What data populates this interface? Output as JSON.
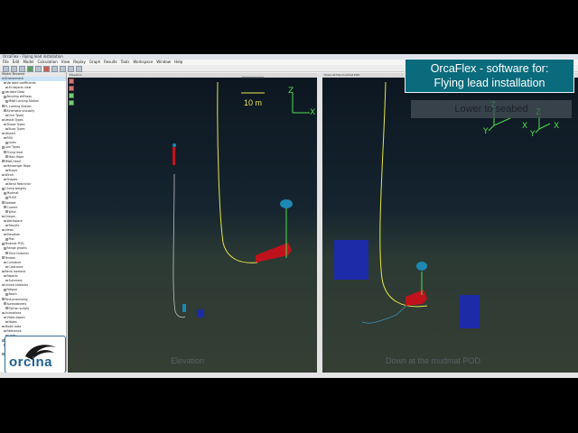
{
  "app": {
    "title": "OrcaFlex - Flying lead installation",
    "menu": [
      "File",
      "Edit",
      "Model",
      "Calculation",
      "View",
      "Replay",
      "Graph",
      "Results",
      "Tools",
      "Workspace",
      "Window",
      "Help"
    ]
  },
  "model_browser": {
    "header": "Model Browser",
    "items": [
      {
        "label": "Environment",
        "selected": true
      },
      {
        "label": "Variable coefficients"
      },
      {
        "label": "All objects view"
      },
      {
        "label": "Variable Data"
      },
      {
        "label": "Bending stiffness"
      },
      {
        "label": "MWA Locking Station"
      },
      {
        "label": "FL Locking Station"
      },
      {
        "label": "Kinematic viscosity"
      },
      {
        "label": "Line Types"
      },
      {
        "label": "Vessel Types"
      },
      {
        "label": "Shape Types"
      },
      {
        "label": "Buoy Types"
      },
      {
        "label": "Vessel1"
      },
      {
        "label": "ROV"
      },
      {
        "label": "Lines"
      },
      {
        "label": "Line Types"
      },
      {
        "label": "Flying lead"
      },
      {
        "label": "Main Rope"
      },
      {
        "label": "MWA Head"
      },
      {
        "label": "Messenger Rope"
      },
      {
        "label": "Buoys"
      },
      {
        "label": "Winch"
      },
      {
        "label": "Shapes"
      },
      {
        "label": "Bend Restrictor"
      },
      {
        "label": "Clump weights"
      },
      {
        "label": "Mudmat"
      },
      {
        "label": "PLEM"
      },
      {
        "label": "Seabed"
      },
      {
        "label": "Current"
      },
      {
        "label": "Wind"
      },
      {
        "label": "Groups"
      },
      {
        "label": "Workspace"
      },
      {
        "label": "Results"
      },
      {
        "label": "Views"
      },
      {
        "label": "Elevation"
      },
      {
        "label": "Plan"
      },
      {
        "label": "Mudmat POD"
      },
      {
        "label": "Range graphs"
      },
      {
        "label": "Time histories"
      },
      {
        "label": "Tension"
      },
      {
        "label": "Curvature"
      },
      {
        "label": "Clearance"
      },
      {
        "label": "Bend moment"
      },
      {
        "label": "Reports"
      },
      {
        "label": "Summary"
      },
      {
        "label": "Linked statistics"
      },
      {
        "label": "Fatigue"
      },
      {
        "label": "Batch"
      },
      {
        "label": "Post-processing"
      },
      {
        "label": "Spreadsheets"
      },
      {
        "label": "Python scripts"
      },
      {
        "label": "Animations"
      },
      {
        "label": "Video export"
      },
      {
        "label": "Notes"
      },
      {
        "label": "Model data"
      },
      {
        "label": "Reference"
      },
      {
        "label": "Units"
      },
      {
        "label": "Tags"
      },
      {
        "label": "Import"
      },
      {
        "label": "Export"
      },
      {
        "label": "Help"
      }
    ]
  },
  "logo": {
    "text": "orcina"
  },
  "views": [
    {
      "label": "Elevation",
      "scale_bar": "10 m"
    },
    {
      "label": "Down at the mudmat POD"
    }
  ],
  "banner": {
    "line1": "OrcaFlex - software for:",
    "line2": "Flying lead installation"
  },
  "stage_button": {
    "label": "Lower to seabed"
  },
  "axes": {
    "z": "Z",
    "x": "X",
    "y": "Y"
  },
  "colors": {
    "banner_bg": "#0a6b7c",
    "line_yellow": "#e8e64a",
    "mudmat_red": "#c0121c",
    "buoy_cyan": "#1d88b3",
    "box_blue": "#1d2ba8",
    "axis_green": "#4de04d",
    "seabed": "#353e33"
  }
}
